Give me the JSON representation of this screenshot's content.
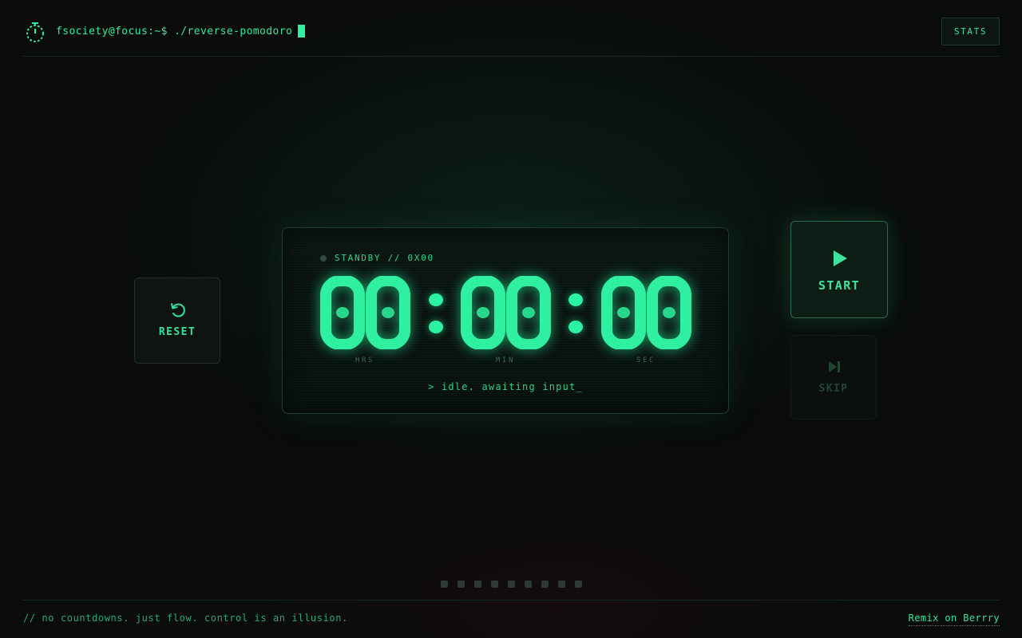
{
  "header": {
    "prompt_user": "fsociety@focus:~$",
    "prompt_command": "./reverse-pomodoro",
    "stats_label": "STATS"
  },
  "clock": {
    "status": "STANDBY // 0X00",
    "hours": "00",
    "minutes": "00",
    "seconds": "00",
    "separator": ":",
    "unit_hours": "HRS",
    "unit_minutes": "MIN",
    "unit_seconds": "SEC",
    "message": "> idle. awaiting input_"
  },
  "controls": {
    "reset_label": "RESET",
    "start_label": "START",
    "skip_label": "SKIP"
  },
  "sessions": {
    "total": 9,
    "completed": 0
  },
  "footer": {
    "tagline": "// no countdowns. just flow. control is an illusion.",
    "remix_label": "Remix on Berrry"
  },
  "colors": {
    "accent": "#2ff0a0",
    "background": "#090c0b",
    "muted": "#2d3a35"
  },
  "icons": {
    "logo": "stopwatch-icon",
    "reset": "reset-icon",
    "start": "play-icon",
    "skip": "skip-next-icon"
  }
}
